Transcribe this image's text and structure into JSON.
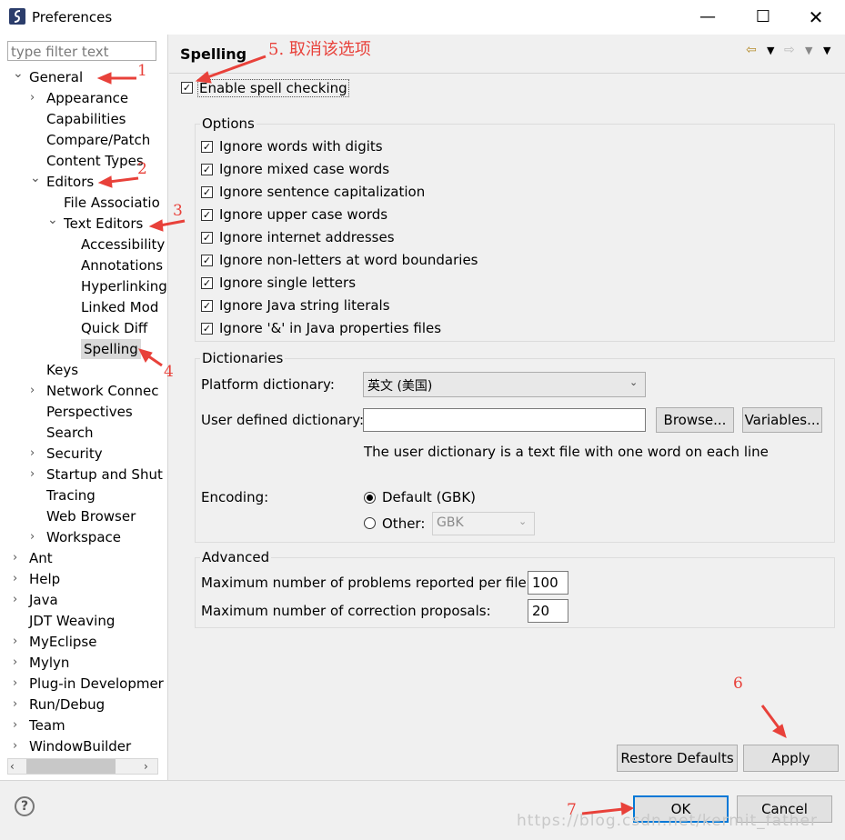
{
  "window": {
    "title": "Preferences"
  },
  "filter": {
    "placeholder": "type filter text"
  },
  "tree": [
    {
      "label": "General",
      "depth": 0,
      "expanded": true
    },
    {
      "label": "Appearance",
      "depth": 1,
      "twisty": "›"
    },
    {
      "label": "Capabilities",
      "depth": 1
    },
    {
      "label": "Compare/Patch",
      "depth": 1
    },
    {
      "label": "Content Types",
      "depth": 1
    },
    {
      "label": "Editors",
      "depth": 1,
      "expanded": true
    },
    {
      "label": "File Associatio",
      "depth": 2
    },
    {
      "label": "Text Editors",
      "depth": 2,
      "expanded": true
    },
    {
      "label": "Accessibility",
      "depth": 3
    },
    {
      "label": "Annotations",
      "depth": 3
    },
    {
      "label": "Hyperlinking",
      "depth": 3
    },
    {
      "label": "Linked Mod",
      "depth": 3
    },
    {
      "label": "Quick Diff",
      "depth": 3
    },
    {
      "label": "Spelling",
      "depth": 3,
      "selected": true
    },
    {
      "label": "Keys",
      "depth": 1
    },
    {
      "label": "Network Connec",
      "depth": 1,
      "twisty": "›"
    },
    {
      "label": "Perspectives",
      "depth": 1
    },
    {
      "label": "Search",
      "depth": 1
    },
    {
      "label": "Security",
      "depth": 1,
      "twisty": "›"
    },
    {
      "label": "Startup and Shut",
      "depth": 1,
      "twisty": "›"
    },
    {
      "label": "Tracing",
      "depth": 1
    },
    {
      "label": "Web Browser",
      "depth": 1
    },
    {
      "label": "Workspace",
      "depth": 1,
      "twisty": "›"
    },
    {
      "label": "Ant",
      "depth": 0,
      "twisty": "›"
    },
    {
      "label": "Help",
      "depth": 0,
      "twisty": "›"
    },
    {
      "label": "Java",
      "depth": 0,
      "twisty": "›"
    },
    {
      "label": "JDT Weaving",
      "depth": 0
    },
    {
      "label": "MyEclipse",
      "depth": 0,
      "twisty": "›"
    },
    {
      "label": "Mylyn",
      "depth": 0,
      "twisty": "›"
    },
    {
      "label": "Plug-in Developmer",
      "depth": 0,
      "twisty": "›"
    },
    {
      "label": "Run/Debug",
      "depth": 0,
      "twisty": "›"
    },
    {
      "label": "Team",
      "depth": 0,
      "twisty": "›"
    },
    {
      "label": "WindowBuilder",
      "depth": 0,
      "twisty": "›"
    }
  ],
  "page": {
    "title": "Spelling",
    "enable_label": "Enable spell checking",
    "enable_checked": true
  },
  "options": {
    "title": "Options",
    "items": [
      "Ignore words with digits",
      "Ignore mixed case words",
      "Ignore sentence capitalization",
      "Ignore upper case words",
      "Ignore internet addresses",
      "Ignore non-letters at word boundaries",
      "Ignore single letters",
      "Ignore Java string literals",
      "Ignore '&' in Java properties files"
    ]
  },
  "dictionaries": {
    "title": "Dictionaries",
    "platform_label": "Platform dictionary:",
    "platform_value": "英文 (美国)",
    "user_label": "User defined dictionary:",
    "user_value": "",
    "browse": "Browse...",
    "variables": "Variables...",
    "hint": "The user dictionary is a text file with one word on each line",
    "encoding_label": "Encoding:",
    "default_label": "Default (GBK)",
    "other_label": "Other:",
    "other_value": "GBK"
  },
  "advanced": {
    "title": "Advanced",
    "max_problems_label": "Maximum number of problems reported per file:",
    "max_problems_value": "100",
    "max_proposals_label": "Maximum number of correction proposals:",
    "max_proposals_value": "20"
  },
  "buttons": {
    "restore": "Restore Defaults",
    "apply": "Apply",
    "ok": "OK",
    "cancel": "Cancel"
  },
  "annotations": {
    "n1": "1",
    "n2": "2",
    "n3": "3",
    "n4": "4",
    "n5": "5. 取消该选项",
    "n6": "6",
    "n7": "7"
  },
  "watermark": "https://blog.csdn.net/kermit_father"
}
